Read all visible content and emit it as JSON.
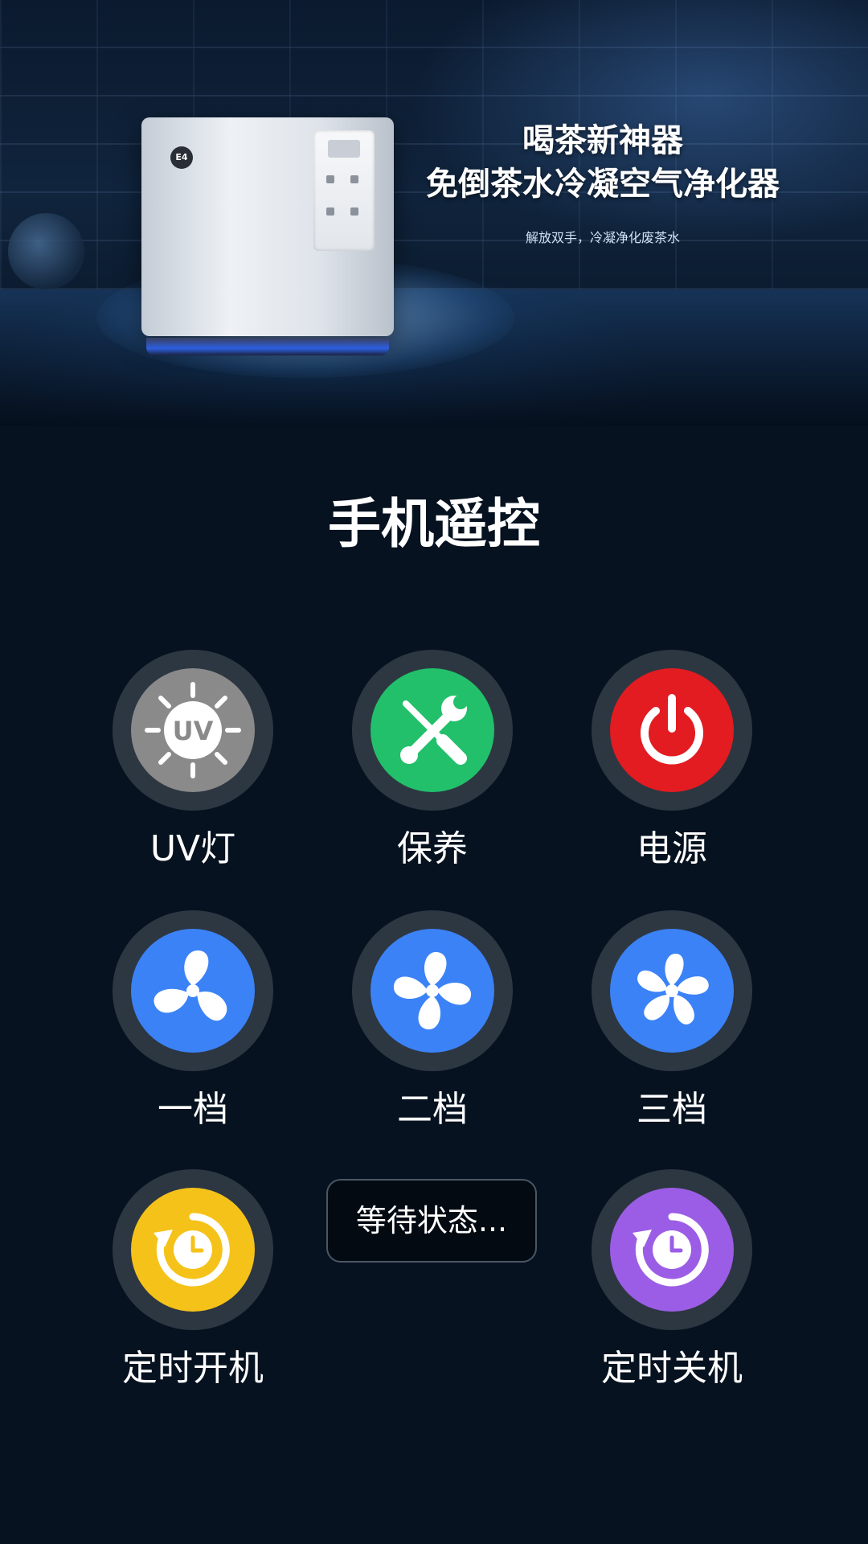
{
  "banner": {
    "device_logo": "E4",
    "title_line1": "喝茶新神器",
    "title_line2": "免倒茶水冷凝空气净化器",
    "subtitle": "解放双手，冷凝净化废茶水"
  },
  "remote": {
    "title": "手机遥控",
    "controls": {
      "uv": {
        "label": "UV灯",
        "icon_text": "UV",
        "color": "#8a8a8a",
        "icon": "uv-sun-icon"
      },
      "maintain": {
        "label": "保养",
        "color": "#22c06a",
        "icon": "tools-icon"
      },
      "power": {
        "label": "电源",
        "color": "#e21c21",
        "icon": "power-icon"
      },
      "speed1": {
        "label": "一档",
        "color": "#3b82f6",
        "icon": "fan-3-blade-icon"
      },
      "speed2": {
        "label": "二档",
        "color": "#3b82f6",
        "icon": "fan-4-blade-icon"
      },
      "speed3": {
        "label": "三档",
        "color": "#3b82f6",
        "icon": "fan-5-blade-icon"
      },
      "timer_on": {
        "label": "定时开机",
        "color": "#f5c21a",
        "icon": "timer-on-icon"
      },
      "timer_off": {
        "label": "定时关机",
        "color": "#9b5de5",
        "icon": "timer-off-icon"
      }
    },
    "status": "等待状态..."
  }
}
